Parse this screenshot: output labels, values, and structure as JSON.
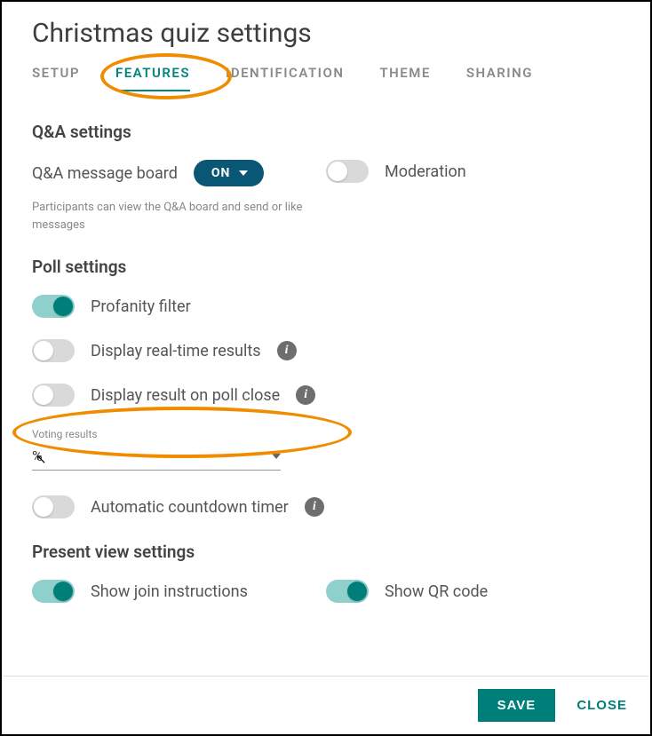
{
  "title": "Christmas quiz settings",
  "tabs": [
    "SETUP",
    "FEATURES",
    "IDENTIFICATION",
    "THEME",
    "SHARING"
  ],
  "qa": {
    "heading": "Q&A settings",
    "board_label": "Q&A message board",
    "on_text": "ON",
    "helper": "Participants can view the Q&A board and send or like messages",
    "moderation_label": "Moderation"
  },
  "poll": {
    "heading": "Poll settings",
    "profanity": "Profanity filter",
    "realtime": "Display real-time results",
    "onclose": "Display result on poll close",
    "select_label": "Voting results",
    "select_value": "%",
    "auto_timer": "Automatic countdown timer"
  },
  "present": {
    "heading": "Present view settings",
    "join": "Show join instructions",
    "qr": "Show QR code"
  },
  "footer": {
    "save": "SAVE",
    "close": "CLOSE"
  }
}
